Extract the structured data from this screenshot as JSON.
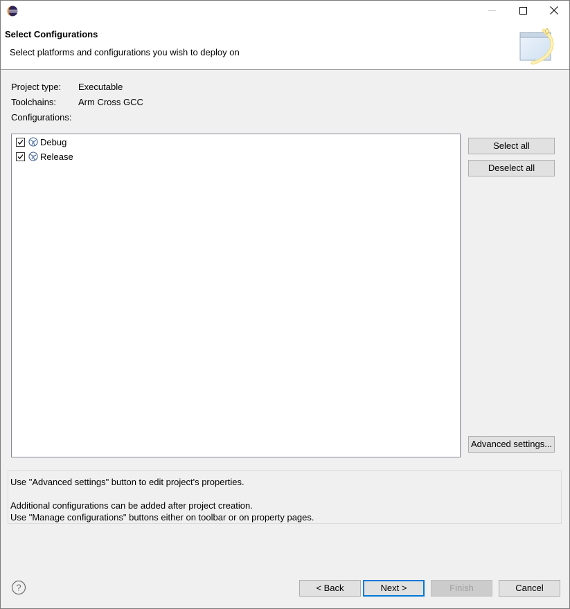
{
  "window": {
    "icon": "eclipse-icon",
    "controls": [
      "minimize-icon",
      "maximize-icon",
      "close-icon"
    ]
  },
  "banner": {
    "title": "Select Configurations",
    "description": "Select platforms and configurations you wish to deploy on",
    "icon": "wizard-banner-icon"
  },
  "info": {
    "project_type_label": "Project type:",
    "project_type_value": "Executable",
    "toolchains_label": "Toolchains:",
    "toolchains_value": "Arm Cross GCC",
    "configurations_label": "Configurations:"
  },
  "configurations": [
    {
      "label": "Debug",
      "checked": true,
      "icon": "configuration-icon"
    },
    {
      "label": "Release",
      "checked": true,
      "icon": "configuration-icon"
    }
  ],
  "side_buttons": {
    "select_all": "Select all",
    "deselect_all": "Deselect all",
    "advanced_settings": "Advanced settings..."
  },
  "hints": {
    "line1": "Use \"Advanced settings\" button to edit project's properties.",
    "line2": "Additional configurations can be added after project creation.",
    "line3": "Use \"Manage configurations\" buttons either on toolbar or on property pages."
  },
  "footer": {
    "help_icon": "help-icon",
    "back": "< Back",
    "next": "Next >",
    "finish": "Finish",
    "finish_enabled": false,
    "cancel": "Cancel"
  },
  "colors": {
    "dialog_background": "#f0f0f0",
    "banner_background": "#ffffff",
    "default_button_border": "#0078d7",
    "disabled_text": "#a0a0a0"
  }
}
